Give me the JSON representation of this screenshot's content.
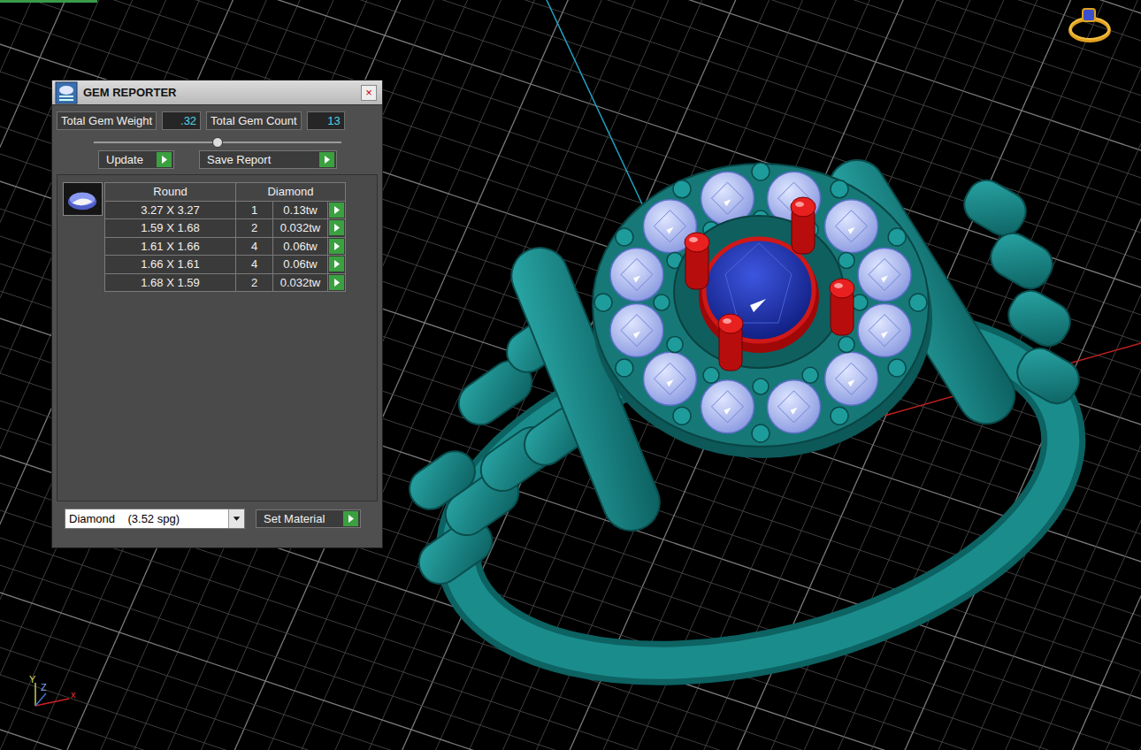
{
  "window": {
    "title": "GEM REPORTER",
    "close": "×"
  },
  "summary": {
    "weight_label": "Total Gem Weight",
    "weight": ".32",
    "count_label": "Total Gem Count",
    "count": "13"
  },
  "slider": {
    "level": 0.5
  },
  "buttons": [
    {
      "label": "Update"
    },
    {
      "label": "Save Report"
    }
  ],
  "table": {
    "columns": [
      "Round",
      "Diamond"
    ],
    "rows": [
      [
        "3.27 X 3.27",
        "1",
        "0.13tw"
      ],
      [
        "1.59 X 1.68",
        "2",
        "0.032tw"
      ],
      [
        "1.61 X 1.66",
        "4",
        "0.06tw"
      ],
      [
        "1.66 X 1.61",
        "4",
        "0.06tw"
      ],
      [
        "1.68 X 1.59",
        "2",
        "0.032tw"
      ]
    ]
  },
  "material": {
    "value": "Diamond    (3.52 spg)",
    "button": "Set Material"
  },
  "axes": [
    "Y",
    "Z",
    "x"
  ]
}
